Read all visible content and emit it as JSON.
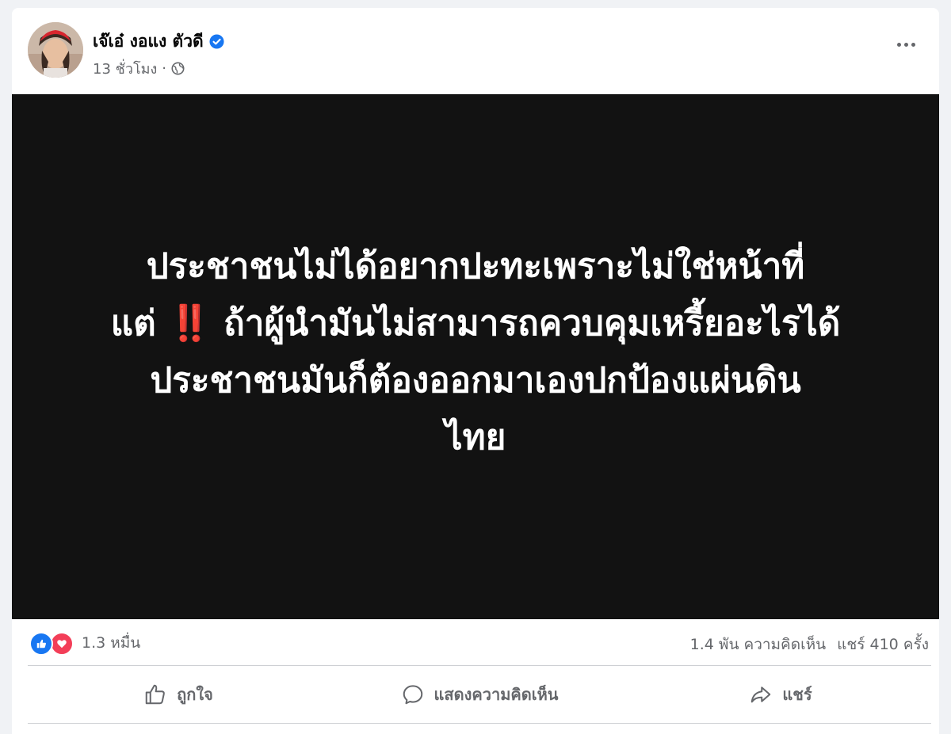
{
  "post": {
    "author": "เจ๊เอ๋ งอแง ตัวดี",
    "time": "13 ชั่วโมง",
    "separator": "·",
    "lines": [
      "ประชาชนไม่ได้อยากปะทะเพราะไม่ใช่หน้าที่",
      "ถ้าผู้นำมันไม่สามารถควบคุมเหรี้ยอะไรได้",
      "ประชาชนมันก็ต้องออกมาเองปกป้องแผ่นดิน",
      "ไทย"
    ],
    "line2_prefix": "แต่",
    "line2_emoji": "‼️"
  },
  "stats": {
    "reactions": "1.3 หมื่น",
    "comments": "1.4 พัน ความคิดเห็น",
    "shares": "แชร์ 410 ครั้ง"
  },
  "actions": {
    "like": "ถูกใจ",
    "comment": "แสดงความคิดเห็น",
    "share": "แชร์"
  },
  "colors": {
    "verified": "#1877f2",
    "like": "#1877f2",
    "love": "#f33e58",
    "post_bg": "#121212",
    "muted": "#65676b"
  },
  "icons": [
    "verified-badge-icon",
    "globe-icon",
    "more-options-icon",
    "like-reaction-icon",
    "love-reaction-icon",
    "thumbs-up-icon",
    "comment-bubble-icon",
    "share-arrow-icon"
  ]
}
